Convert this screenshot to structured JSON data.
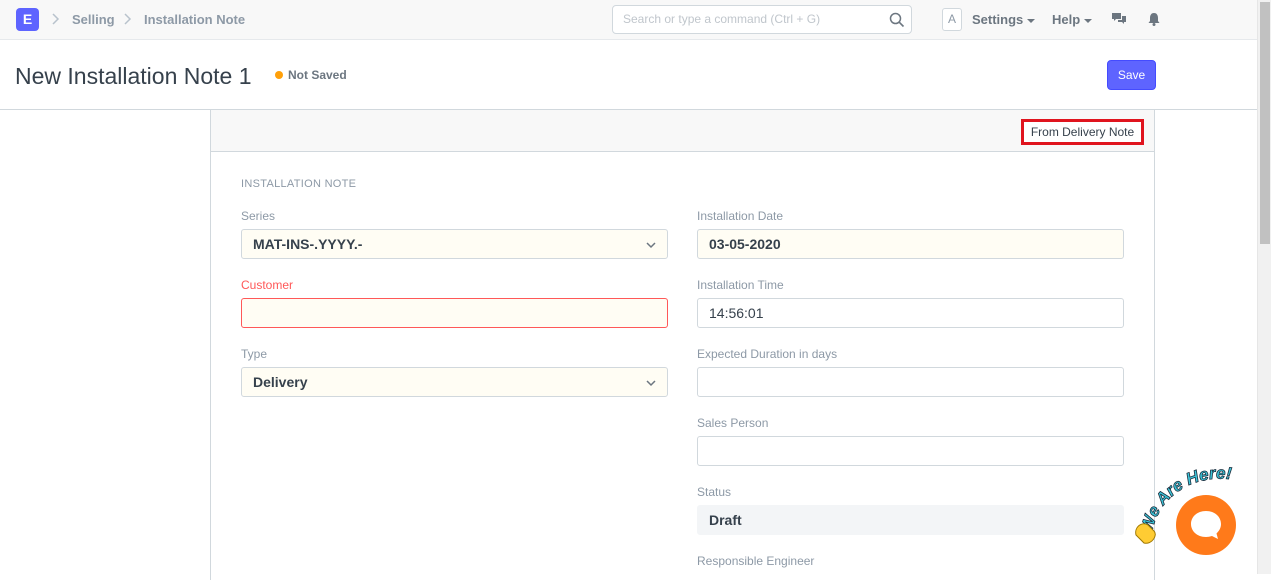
{
  "app": {
    "logo_letter": "E"
  },
  "breadcrumb": [
    "Selling",
    "Installation Note"
  ],
  "search": {
    "placeholder": "Search or type a command (Ctrl + G)"
  },
  "navbar": {
    "avatar_letter": "A",
    "settings_label": "Settings",
    "help_label": "Help"
  },
  "page": {
    "title": "New Installation Note 1",
    "status": "Not Saved",
    "save_label": "Save"
  },
  "toolbar": {
    "from_delivery_note": "From Delivery Note"
  },
  "form": {
    "section_title": "INSTALLATION NOTE",
    "series": {
      "label": "Series",
      "value": "MAT-INS-.YYYY.-"
    },
    "customer": {
      "label": "Customer",
      "value": ""
    },
    "type": {
      "label": "Type",
      "value": "Delivery"
    },
    "installation_date": {
      "label": "Installation Date",
      "value": "03-05-2020"
    },
    "installation_time": {
      "label": "Installation Time",
      "value": "14:56:01"
    },
    "expected_duration": {
      "label": "Expected Duration in days",
      "value": ""
    },
    "sales_person": {
      "label": "Sales Person",
      "value": ""
    },
    "status": {
      "label": "Status",
      "value": "Draft"
    },
    "responsible_engineer": {
      "label": "Responsible Engineer"
    }
  },
  "chat": {
    "tagline": "We Are Here!"
  },
  "colors": {
    "accent": "#5e64ff",
    "warning": "#ffa00a",
    "error": "#ff5858",
    "highlight": "#e0141e",
    "chat": "#ff7a1a"
  }
}
